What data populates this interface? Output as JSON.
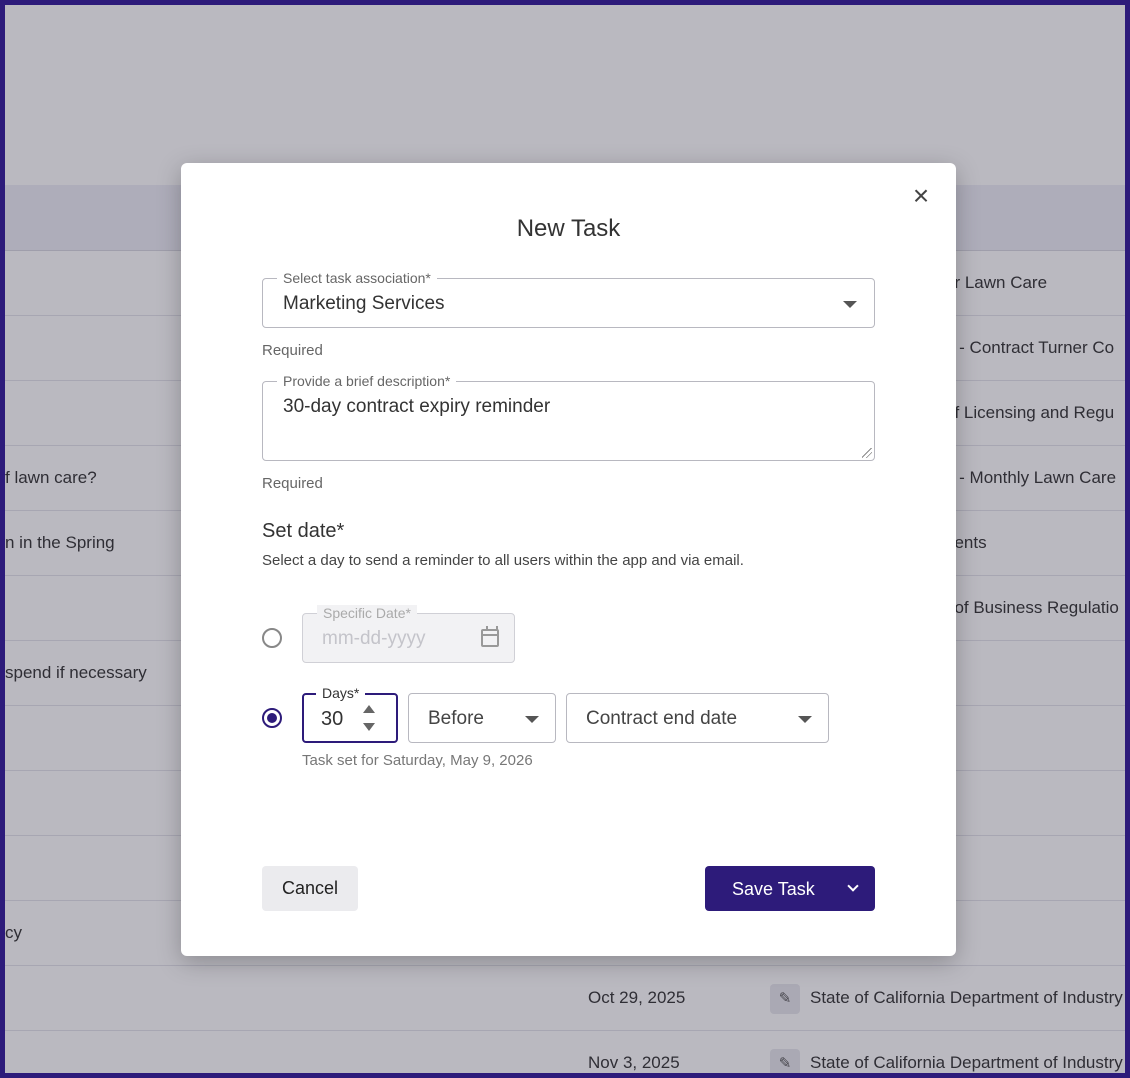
{
  "background": {
    "rows": [
      {
        "left": "",
        "right": "ar Lawn Care"
      },
      {
        "left": "",
        "right": "n - Contract Turner Co"
      },
      {
        "left": "",
        "right": "of Licensing and Regu"
      },
      {
        "left": "f lawn care?",
        "right": "g - Monthly Lawn Care"
      },
      {
        "left": "n in the Spring",
        "right": "nents"
      },
      {
        "left": "",
        "right": "t of Business Regulatio"
      },
      {
        "left": " spend if necessary",
        "right": ""
      },
      {
        "left": "",
        "right": ""
      },
      {
        "left": "",
        "right": ""
      },
      {
        "left": "",
        "right": ""
      },
      {
        "left": "cy",
        "right": ""
      },
      {
        "left": "",
        "date": "Oct 29, 2025",
        "org": "State of California Department of Industry"
      },
      {
        "left": "",
        "date": "Nov 3, 2025",
        "org": "State of California Department of Industry"
      }
    ]
  },
  "modal": {
    "title": "New Task",
    "close_label": "×",
    "association": {
      "legend": "Select task association*",
      "value": "Marketing Services",
      "helper": "Required"
    },
    "description": {
      "legend": "Provide a brief description*",
      "value": "30-day contract expiry reminder",
      "helper": "Required"
    },
    "set_date": {
      "title": "Set date*",
      "description": "Select a day to send a reminder to all users within the app and via email.",
      "specific_date": {
        "legend": "Specific Date*",
        "placeholder": "mm-dd-yyyy",
        "selected": false
      },
      "relative": {
        "selected": true,
        "days_legend": "Days*",
        "days_value": "30",
        "direction": "Before",
        "reference": "Contract end date",
        "summary": "Task set for Saturday, May 9, 2026"
      }
    },
    "cancel_label": "Cancel",
    "save_label": "Save Task"
  },
  "colors": {
    "accent": "#2d1b7a",
    "overlay": "rgba(40,38,60,0.32)"
  }
}
